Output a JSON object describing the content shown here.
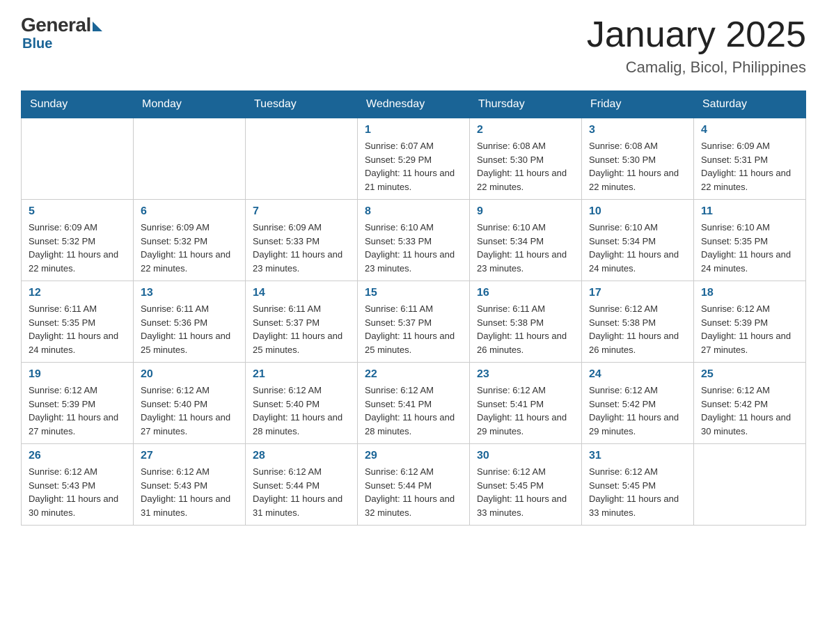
{
  "logo": {
    "general": "General",
    "blue": "Blue"
  },
  "header": {
    "month": "January 2025",
    "location": "Camalig, Bicol, Philippines"
  },
  "days_of_week": [
    "Sunday",
    "Monday",
    "Tuesday",
    "Wednesday",
    "Thursday",
    "Friday",
    "Saturday"
  ],
  "weeks": [
    [
      {
        "day": "",
        "info": ""
      },
      {
        "day": "",
        "info": ""
      },
      {
        "day": "",
        "info": ""
      },
      {
        "day": "1",
        "info": "Sunrise: 6:07 AM\nSunset: 5:29 PM\nDaylight: 11 hours and 21 minutes."
      },
      {
        "day": "2",
        "info": "Sunrise: 6:08 AM\nSunset: 5:30 PM\nDaylight: 11 hours and 22 minutes."
      },
      {
        "day": "3",
        "info": "Sunrise: 6:08 AM\nSunset: 5:30 PM\nDaylight: 11 hours and 22 minutes."
      },
      {
        "day": "4",
        "info": "Sunrise: 6:09 AM\nSunset: 5:31 PM\nDaylight: 11 hours and 22 minutes."
      }
    ],
    [
      {
        "day": "5",
        "info": "Sunrise: 6:09 AM\nSunset: 5:32 PM\nDaylight: 11 hours and 22 minutes."
      },
      {
        "day": "6",
        "info": "Sunrise: 6:09 AM\nSunset: 5:32 PM\nDaylight: 11 hours and 22 minutes."
      },
      {
        "day": "7",
        "info": "Sunrise: 6:09 AM\nSunset: 5:33 PM\nDaylight: 11 hours and 23 minutes."
      },
      {
        "day": "8",
        "info": "Sunrise: 6:10 AM\nSunset: 5:33 PM\nDaylight: 11 hours and 23 minutes."
      },
      {
        "day": "9",
        "info": "Sunrise: 6:10 AM\nSunset: 5:34 PM\nDaylight: 11 hours and 23 minutes."
      },
      {
        "day": "10",
        "info": "Sunrise: 6:10 AM\nSunset: 5:34 PM\nDaylight: 11 hours and 24 minutes."
      },
      {
        "day": "11",
        "info": "Sunrise: 6:10 AM\nSunset: 5:35 PM\nDaylight: 11 hours and 24 minutes."
      }
    ],
    [
      {
        "day": "12",
        "info": "Sunrise: 6:11 AM\nSunset: 5:35 PM\nDaylight: 11 hours and 24 minutes."
      },
      {
        "day": "13",
        "info": "Sunrise: 6:11 AM\nSunset: 5:36 PM\nDaylight: 11 hours and 25 minutes."
      },
      {
        "day": "14",
        "info": "Sunrise: 6:11 AM\nSunset: 5:37 PM\nDaylight: 11 hours and 25 minutes."
      },
      {
        "day": "15",
        "info": "Sunrise: 6:11 AM\nSunset: 5:37 PM\nDaylight: 11 hours and 25 minutes."
      },
      {
        "day": "16",
        "info": "Sunrise: 6:11 AM\nSunset: 5:38 PM\nDaylight: 11 hours and 26 minutes."
      },
      {
        "day": "17",
        "info": "Sunrise: 6:12 AM\nSunset: 5:38 PM\nDaylight: 11 hours and 26 minutes."
      },
      {
        "day": "18",
        "info": "Sunrise: 6:12 AM\nSunset: 5:39 PM\nDaylight: 11 hours and 27 minutes."
      }
    ],
    [
      {
        "day": "19",
        "info": "Sunrise: 6:12 AM\nSunset: 5:39 PM\nDaylight: 11 hours and 27 minutes."
      },
      {
        "day": "20",
        "info": "Sunrise: 6:12 AM\nSunset: 5:40 PM\nDaylight: 11 hours and 27 minutes."
      },
      {
        "day": "21",
        "info": "Sunrise: 6:12 AM\nSunset: 5:40 PM\nDaylight: 11 hours and 28 minutes."
      },
      {
        "day": "22",
        "info": "Sunrise: 6:12 AM\nSunset: 5:41 PM\nDaylight: 11 hours and 28 minutes."
      },
      {
        "day": "23",
        "info": "Sunrise: 6:12 AM\nSunset: 5:41 PM\nDaylight: 11 hours and 29 minutes."
      },
      {
        "day": "24",
        "info": "Sunrise: 6:12 AM\nSunset: 5:42 PM\nDaylight: 11 hours and 29 minutes."
      },
      {
        "day": "25",
        "info": "Sunrise: 6:12 AM\nSunset: 5:42 PM\nDaylight: 11 hours and 30 minutes."
      }
    ],
    [
      {
        "day": "26",
        "info": "Sunrise: 6:12 AM\nSunset: 5:43 PM\nDaylight: 11 hours and 30 minutes."
      },
      {
        "day": "27",
        "info": "Sunrise: 6:12 AM\nSunset: 5:43 PM\nDaylight: 11 hours and 31 minutes."
      },
      {
        "day": "28",
        "info": "Sunrise: 6:12 AM\nSunset: 5:44 PM\nDaylight: 11 hours and 31 minutes."
      },
      {
        "day": "29",
        "info": "Sunrise: 6:12 AM\nSunset: 5:44 PM\nDaylight: 11 hours and 32 minutes."
      },
      {
        "day": "30",
        "info": "Sunrise: 6:12 AM\nSunset: 5:45 PM\nDaylight: 11 hours and 33 minutes."
      },
      {
        "day": "31",
        "info": "Sunrise: 6:12 AM\nSunset: 5:45 PM\nDaylight: 11 hours and 33 minutes."
      },
      {
        "day": "",
        "info": ""
      }
    ]
  ]
}
